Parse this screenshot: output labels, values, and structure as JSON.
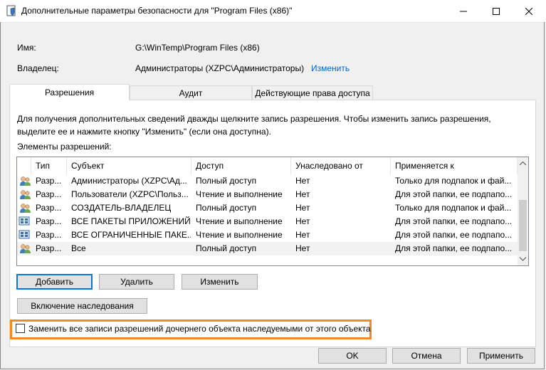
{
  "window": {
    "title": "Дополнительные параметры безопасности  для \"Program Files (x86)\""
  },
  "info": {
    "name_label": "Имя:",
    "name_value": "G:\\WinTemp\\Program Files (x86)",
    "owner_label": "Владелец:",
    "owner_value": "Администраторы (XZPC\\Администраторы)",
    "owner_change_link": "Изменить"
  },
  "tabs": [
    {
      "label": "Разрешения",
      "active": true
    },
    {
      "label": "Аудит",
      "active": false
    },
    {
      "label": "Действующие права доступа",
      "active": false
    }
  ],
  "permissions": {
    "description": "Для получения дополнительных сведений дважды щелкните запись разрешения. Чтобы изменить запись разрешения, выделите ее и нажмите кнопку \"Изменить\" (если она доступна).",
    "list_label": "Элементы разрешений:",
    "columns": [
      "Тип",
      "Субъект",
      "Доступ",
      "Унаследовано от",
      "Применяется к"
    ],
    "rows": [
      {
        "icon": "users-group-icon",
        "type": "Разр...",
        "subject": "Администраторы (XZPC\\Ад...",
        "access": "Полный доступ",
        "inherited": "Нет",
        "applies": "Только для подпапок и фай..."
      },
      {
        "icon": "users-group-icon",
        "type": "Разр...",
        "subject": "Пользователи (XZPC\\Польз...",
        "access": "Чтение и выполнение",
        "inherited": "Нет",
        "applies": "Для этой папки, ее подпапо..."
      },
      {
        "icon": "users-group-icon",
        "type": "Разр...",
        "subject": "СОЗДАТЕЛЬ-ВЛАДЕЛЕЦ",
        "access": "Полный доступ",
        "inherited": "Нет",
        "applies": "Только для подпапок и фай..."
      },
      {
        "icon": "app-packages-icon",
        "type": "Разр...",
        "subject": "ВСЕ ПАКЕТЫ ПРИЛОЖЕНИЙ",
        "access": "Чтение и выполнение",
        "inherited": "Нет",
        "applies": "Для этой папки, ее подпапо..."
      },
      {
        "icon": "app-packages-icon",
        "type": "Разр...",
        "subject": "ВСЕ ОГРАНИЧЕННЫЕ ПАКЕ...",
        "access": "Чтение и выполнение",
        "inherited": "Нет",
        "applies": "Для этой папки, ее подпапо..."
      },
      {
        "icon": "users-group-icon",
        "type": "Разр...",
        "subject": "Все",
        "access": "Полный доступ",
        "inherited": "Нет",
        "applies": "Для этой папки, ее подпапо...",
        "selected": true
      }
    ],
    "buttons": {
      "add": "Добавить",
      "remove": "Удалить",
      "edit": "Изменить",
      "enable_inheritance": "Включение наследования"
    },
    "replace_checkbox": {
      "label": "Заменить все записи разрешений дочернего объекта наследуемыми от этого объекта",
      "checked": false
    }
  },
  "footer": {
    "ok": "OK",
    "cancel": "Отмена",
    "apply": "Применить"
  },
  "colors": {
    "highlight_border": "#f28a1f",
    "link": "#0066cc",
    "default_button_border": "#0078d7"
  }
}
